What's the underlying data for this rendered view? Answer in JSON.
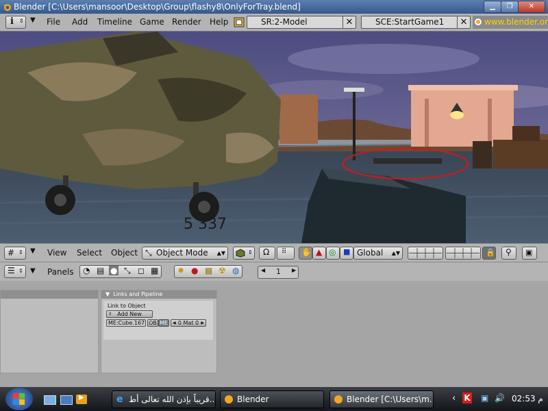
{
  "window": {
    "title": "Blender [C:\\Users\\mansoor\\Desktop\\Group\\flashy8\\OnlyForTray.blend]"
  },
  "menubar": {
    "menus": [
      "File",
      "Add",
      "Timeline",
      "Game",
      "Render",
      "Help"
    ],
    "screen_field": "SR:2-Model",
    "scene_field": "SCE:StartGame1",
    "url_text": "www.blender.org"
  },
  "viewport": {
    "plate_text": "5 337"
  },
  "view3d_header": {
    "menus": [
      "View",
      "Select",
      "Object"
    ],
    "mode_select": "Object Mode",
    "orientation_select": "Global"
  },
  "buttons_header": {
    "panels_label": "Panels",
    "frame_value": "1"
  },
  "links_panel": {
    "title": "Links and Pipeline",
    "link_label": "Link to Object",
    "add_new": "Add New",
    "mesh_name": "ME:Cube.167",
    "ob_label": "OB",
    "me_label": "ME",
    "mat_label": "0 Mat 0"
  },
  "taskbar": {
    "tasks": [
      "قريباً بإذن الله تعالى أط...",
      "Blender",
      "Blender [C:\\Users\\m..."
    ],
    "clock": "02:53",
    "clock_suffix": "م"
  },
  "colors": {
    "title_bar": "#4a6fa5",
    "menu_bg": "#b4b4b4",
    "buttons_bg": "#a5a5a5",
    "taskbar": "#1f2326",
    "highlight_ellipse": "#d01818"
  }
}
